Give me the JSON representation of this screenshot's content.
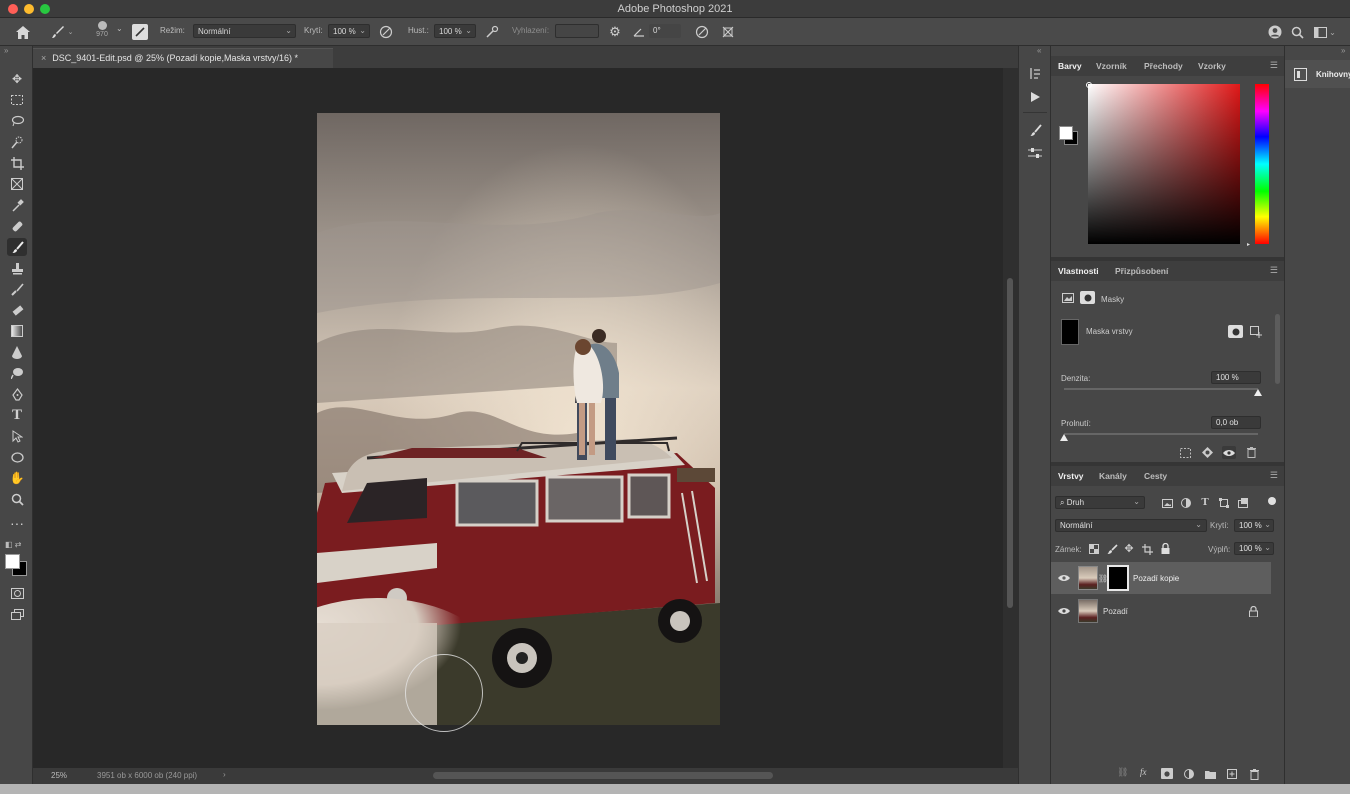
{
  "window": {
    "title": "Adobe Photoshop 2021"
  },
  "options_bar": {
    "brush_size": "970",
    "mode_label": "Režim:",
    "mode_value": "Normální",
    "opacity_label": "Krytí:",
    "opacity_value": "100 %",
    "flow_label": "Hust.:",
    "flow_value": "100 %",
    "smoothing_label": "Vyhlazení:",
    "angle_value": "0°"
  },
  "document": {
    "tab_title": "DSC_9401-Edit.psd @ 25% (Pozadí kopie,Maska vrstvy/16) *",
    "zoom": "25%",
    "dimensions": "3951 ob x 6000 ob (240 ppi)"
  },
  "color_panel": {
    "tabs": [
      "Barvy",
      "Vzorník",
      "Přechody",
      "Vzorky"
    ],
    "active_tab": "Barvy",
    "foreground_color": "#ffffff",
    "background_color": "#000000",
    "hue_color": "#e01818"
  },
  "properties_panel": {
    "tabs": [
      "Vlastnosti",
      "Přizpůsobení"
    ],
    "section": "Masky",
    "mask_name": "Maska vrstvy",
    "density_label": "Denzita:",
    "density_value": "100 %",
    "feather_label": "Prolnutí:",
    "feather_value": "0,0 ob",
    "density_fraction": 1.0,
    "feather_fraction": 0.0
  },
  "layers_panel": {
    "tabs": [
      "Vrstvy",
      "Kanály",
      "Cesty"
    ],
    "filter_label": "Druh",
    "blend_mode": "Normální",
    "opacity_label": "Krytí:",
    "opacity_value": "100 %",
    "lock_label": "Zámek:",
    "fill_label": "Výplň:",
    "fill_value": "100 %",
    "layers": [
      {
        "name": "Pozadí kopie",
        "selected": true,
        "has_mask": true,
        "locked": false
      },
      {
        "name": "Pozadí",
        "selected": false,
        "has_mask": false,
        "locked": true
      }
    ]
  },
  "libraries_panel": {
    "label": "Knihovny"
  }
}
